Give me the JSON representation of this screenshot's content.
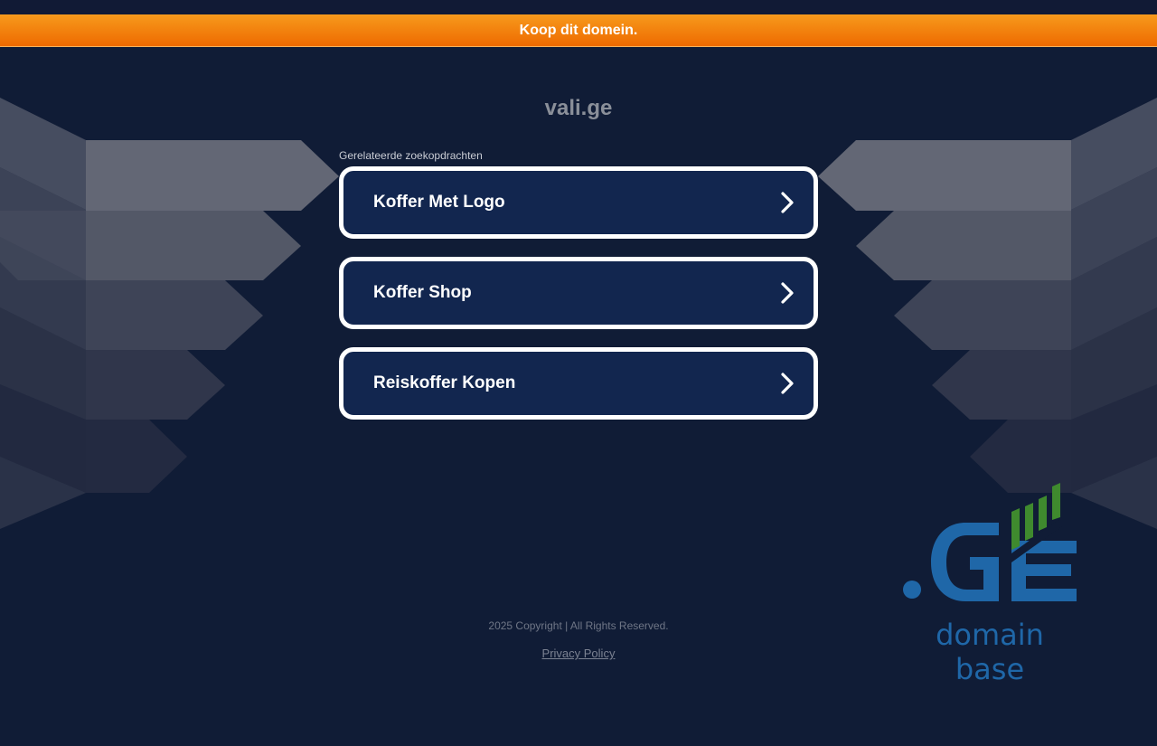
{
  "banner": {
    "text": "Koop dit domein."
  },
  "domain": {
    "name": "vali.ge"
  },
  "related": {
    "label": "Gerelateerde zoekopdrachten",
    "items": [
      {
        "label": "Koffer Met Logo"
      },
      {
        "label": "Koffer Shop"
      },
      {
        "label": "Reiskoffer Kopen"
      }
    ]
  },
  "logo": {
    "wordmark": ".GE",
    "tagline": "domain base",
    "colors": {
      "blue": "#1f67a8",
      "green": "#3f8a2e"
    }
  },
  "footer": {
    "copyright": "2025 Copyright | All Rights Reserved.",
    "privacy_label": "Privacy Policy"
  },
  "colors": {
    "background": "#101c36",
    "banner_orange": "#f28a10",
    "card_fill": "#12264f",
    "card_border": "#ffffff"
  },
  "icons": {
    "chevron": "chevron-right-icon"
  }
}
